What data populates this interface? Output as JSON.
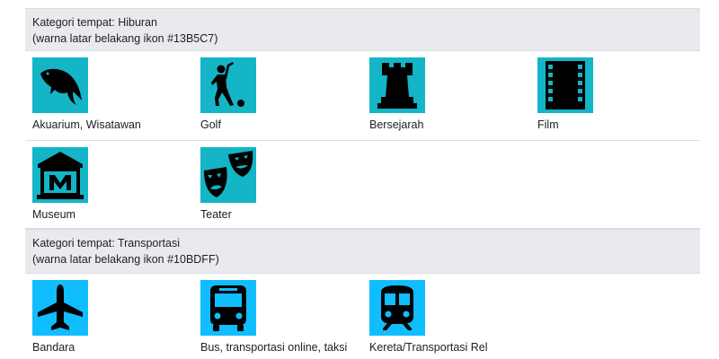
{
  "sections": [
    {
      "title": "Kategori tempat: Hiburan",
      "subtitle": "(warna latar belakang ikon #13B5C7)",
      "bg_color": "#13B5C7",
      "items": [
        {
          "label": "Akuarium, Wisatawan",
          "icon": "dolphin-icon"
        },
        {
          "label": "Golf",
          "icon": "golfer-icon"
        },
        {
          "label": "Bersejarah",
          "icon": "castle-tower-icon"
        },
        {
          "label": "Film",
          "icon": "film-strip-icon"
        },
        {
          "label": "Museum",
          "icon": "museum-icon"
        },
        {
          "label": "Teater",
          "icon": "theater-masks-icon"
        }
      ]
    },
    {
      "title": "Kategori tempat: Transportasi",
      "subtitle": "(warna latar belakang ikon #10BDFF)",
      "bg_color": "#10BDFF",
      "items": [
        {
          "label": "Bandara",
          "icon": "airplane-icon"
        },
        {
          "label": "Bus, transportasi online, taksi",
          "icon": "bus-icon"
        },
        {
          "label": "Kereta/Transportasi Rel",
          "icon": "train-icon"
        }
      ]
    }
  ]
}
